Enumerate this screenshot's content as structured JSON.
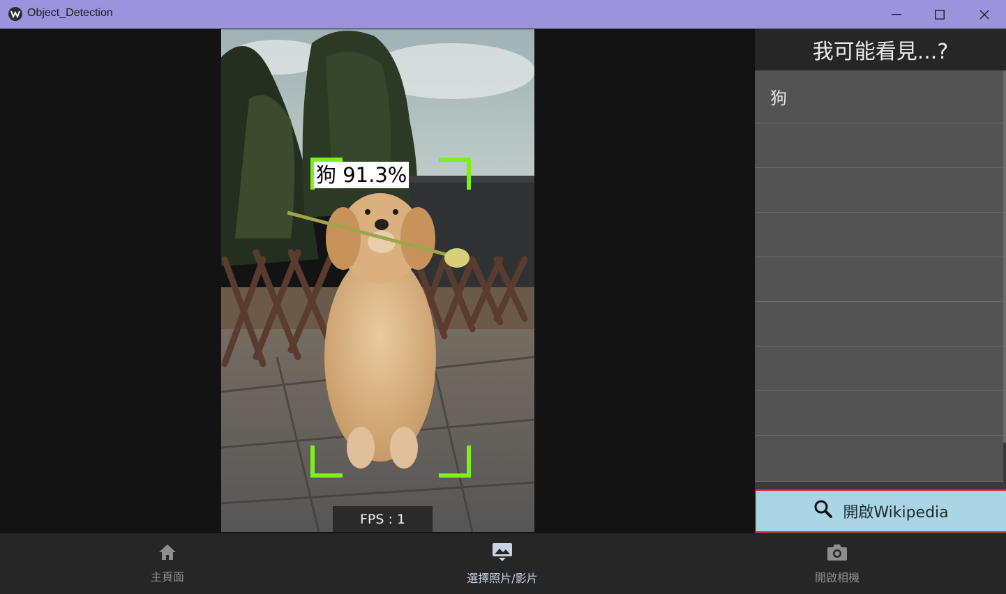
{
  "window": {
    "title": "Object_Detection"
  },
  "viewer": {
    "detection": {
      "label": "狗 91.3%",
      "box_color": "#7df019"
    },
    "fps_text": "FPS : 1"
  },
  "panel": {
    "header": "我可能看見...?",
    "items": [
      "狗",
      "",
      "",
      "",
      "",
      "",
      "",
      "",
      ""
    ],
    "wiki_button": "開啟Wikipedia",
    "wiki_button_color": "#a9d5e5",
    "wiki_border_color": "#e0303c"
  },
  "nav": {
    "items": [
      {
        "label": "主頁面",
        "icon": "home-icon"
      },
      {
        "label": "選擇照片/影片",
        "icon": "image-icon"
      },
      {
        "label": "開啟相機",
        "icon": "camera-icon"
      }
    ]
  }
}
